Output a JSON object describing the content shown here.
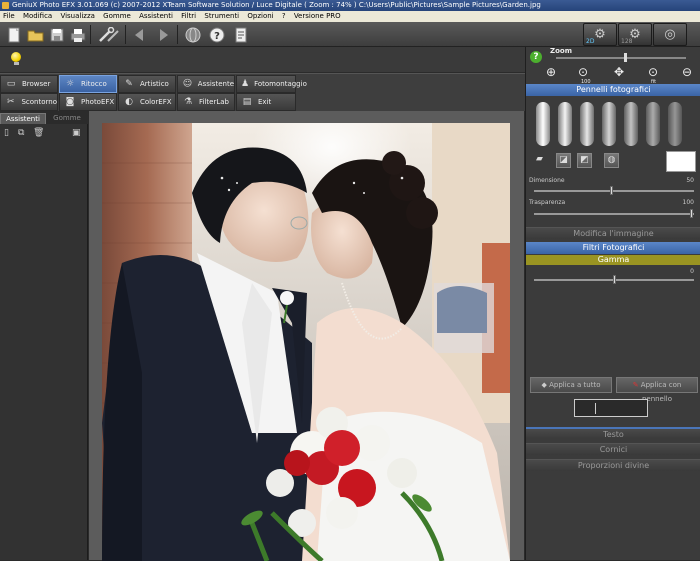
{
  "window": {
    "title": "GeniuX Photo EFX 3.01.069 (c) 2007-2012 XTeam Software Solution / Luce Digitale ( Zoom : 74% ) C:\\Users\\Public\\Pictures\\Sample Pictures\\Garden.jpg"
  },
  "menu": [
    "File",
    "Modifica",
    "Visualizza",
    "Gomme",
    "Assistenti",
    "Filtri",
    "Strumenti",
    "Opzioni",
    "?",
    "Versione PRO"
  ],
  "toolbar": {
    "view_2d": "2D",
    "view_3d_label": "128"
  },
  "modes": [
    {
      "label": "Browser",
      "icon": "folder-icon"
    },
    {
      "label": "Ritocco",
      "icon": "sun-icon",
      "active": true
    },
    {
      "label": "Artistico",
      "icon": "brush-icon"
    },
    {
      "label": "Assistente",
      "icon": "smiley-icon"
    },
    {
      "label": "Fotomontaggio",
      "icon": "people-icon"
    },
    {
      "label": "Scontorno",
      "icon": "scissors-icon"
    },
    {
      "label": "PhotoEFX",
      "icon": "camera-icon"
    },
    {
      "label": "ColorEFX",
      "icon": "palette-icon"
    },
    {
      "label": "FilterLab",
      "icon": "flask-icon"
    },
    {
      "label": "Exit",
      "icon": "exit-icon"
    }
  ],
  "left_tabs": {
    "active": "Assistenti",
    "inactive": "Gomme"
  },
  "right_panel": {
    "zoom_label": "Zoom",
    "zoom_icon_labels": [
      "",
      "100",
      "",
      "fit",
      ""
    ],
    "brushes_header": "Pennelli fotografici",
    "dimension_label": "Dimensione",
    "dimension_value": "50",
    "transparency_label": "Trasparenza",
    "transparency_value": "100",
    "modify_header": "Modifica l'immagine",
    "filters_header": "Filtri Fotografici",
    "gamma_header": "Gamma",
    "gamma_value": "0",
    "apply_all": "Applica a tutto",
    "apply_brush": "Applica con pennello",
    "text_header": "Testo",
    "frames_header": "Cornici",
    "proportions_header": "Proporzioni divine"
  },
  "colors": {
    "accent_blue": "#4a75b8",
    "gamma_olive": "#9a9422",
    "panel_bg": "#3b3b3b"
  }
}
